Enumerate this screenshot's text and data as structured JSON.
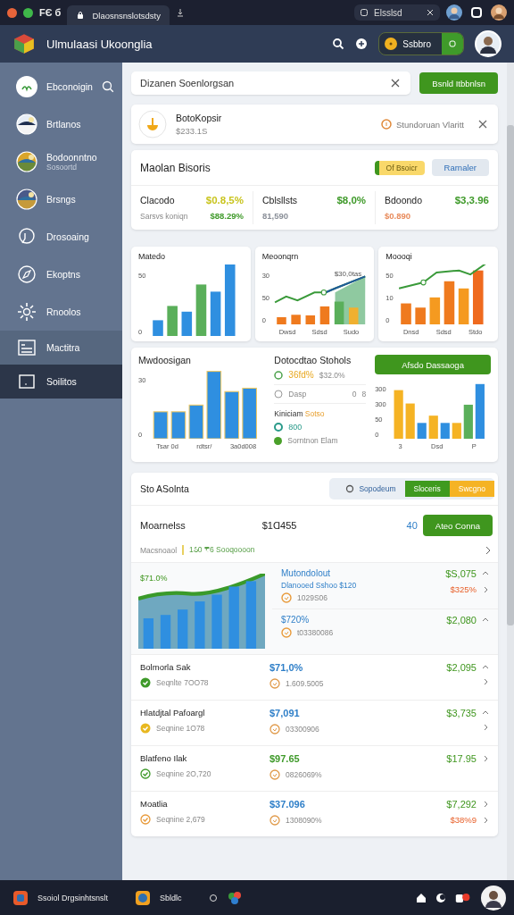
{
  "browser": {
    "app_label": "FЄ б",
    "tab_title": "Dlaosnsnslotsdsty",
    "address": "Elsslsd"
  },
  "header": {
    "title": "Ulmulaasi Ukoonglia",
    "pill_label": "Ssbbro"
  },
  "sidebar": {
    "items": [
      {
        "label": "Ebconoigin",
        "kind": "logo",
        "highlighted": false,
        "selected": false
      },
      {
        "label": "Brtlanos",
        "kind": "picture",
        "highlighted": false,
        "selected": false
      },
      {
        "label": "Bodoonntno",
        "subtitle": "Sosoortd",
        "kind": "picture",
        "highlighted": false,
        "selected": false
      },
      {
        "label": "Brsngs",
        "kind": "picture",
        "highlighted": false,
        "selected": false
      },
      {
        "label": "Drosoaing",
        "kind": "chat",
        "highlighted": false,
        "selected": false
      },
      {
        "label": "Ekoptns",
        "kind": "compass",
        "highlighted": false,
        "selected": false
      },
      {
        "label": "Rnoolos",
        "kind": "gear",
        "highlighted": false,
        "selected": false
      },
      {
        "label": "Mactitra",
        "kind": "list",
        "highlighted": true,
        "selected": false
      },
      {
        "label": "Soilitos",
        "kind": "square",
        "highlighted": false,
        "selected": true
      }
    ]
  },
  "search": {
    "value": "Dizanen Soenlorgsan",
    "button": "Bsnld Itbbnlsn"
  },
  "notice": {
    "title": "BotoKopsir",
    "amount": "$233.1Ѕ",
    "chip": "Stundoruan Vlaritt"
  },
  "summary": {
    "title": "Maolan Bisoris",
    "badge": "Of Bsoicr",
    "button": "Rarnaler",
    "metrics": [
      {
        "name": "Clacodo",
        "value": {
          "text": "$0.8,5%",
          "color": "#c9c41e"
        },
        "sub": "Sarsvs koniqn",
        "sub_value": {
          "text": "$88.29%",
          "color": "#3f9a2a"
        }
      },
      {
        "name": "Cblsllsts",
        "value": {
          "text": "$8,0%",
          "color": "#3f9a2a"
        },
        "sub_value": {
          "text": "81,590",
          "color": "#8a8f98"
        }
      },
      {
        "name": "Bdoondo",
        "value": {
          "text": "$3,3.96",
          "color": "#3f9a2a"
        },
        "sub_value": {
          "text": "$0.890",
          "color": "#e88a5a"
        }
      }
    ]
  },
  "charts": [
    {
      "title": "Matedo",
      "kind": "bars",
      "ticks": [
        "50",
        "0"
      ]
    },
    {
      "title": "Meoonqrn",
      "kind": "combo_area",
      "label": "$30,0tas",
      "ticks": [
        "30",
        "50",
        "0"
      ],
      "x_labels": [
        "Dwsd",
        "Sdsd",
        "Sudo"
      ]
    },
    {
      "title": "Moooqi",
      "kind": "combo",
      "ticks": [
        "50",
        "10",
        "0"
      ],
      "x_labels": [
        "Dnsd",
        "Sdsd",
        "Stdo"
      ]
    }
  ],
  "detail": {
    "title": "Mwdoosigan",
    "ticks": [
      "30",
      "0"
    ],
    "x_labels": [
      "Tsar 0d",
      "rdtsr/",
      "3a0d008"
    ],
    "stats_title": "Dotocdtao Stohols",
    "stat_primary": "36fd%",
    "stat_secondary": "$32.0%",
    "line_label": "Dasp",
    "line_values": [
      "0",
      "8"
    ],
    "sub_title": "Kiniciam",
    "sub_title_accent": "Sotso",
    "count": "800",
    "legend": "Sorntnon Elam",
    "button": "Afsdo Dassaoga",
    "right_ticks": [
      "300",
      "300",
      "50",
      "0"
    ],
    "right_x_labels": [
      "3",
      "Dsd",
      "P"
    ]
  },
  "accounts": {
    "title": "Sto ASolnta",
    "segments": [
      {
        "label": "Sopodeum",
        "kind": "plain"
      },
      {
        "label": "Sloceris",
        "kind": "filled",
        "color": "#3f9a1e"
      },
      {
        "label": "Swcgno",
        "kind": "filled",
        "color": "#f5b324"
      }
    ],
    "name": "Moarnelss",
    "total": "$1Ɑ455",
    "count": "40",
    "button": "Ateo Conna",
    "sub_name": "Macsnoaol",
    "sub_value": "1ઠ0 ₹6 Sooqoooon",
    "chart_label": "$71.0%",
    "featured": [
      {
        "title": "Mutondolout",
        "detail": "Dlanooed Sshoo $120",
        "code": "1029S06",
        "value": "$S,075",
        "value_sub": "$325%"
      },
      {
        "title": "$720%",
        "code": "t03380086",
        "value": "$2,080"
      }
    ],
    "rows": [
      {
        "name": "Bolmorla Sak",
        "status": {
          "text": "Seqnlte 7ОО78",
          "color": "#3f9a2a",
          "filled": true
        },
        "amount": {
          "text": "$71,0%",
          "color": "#2f7fc8"
        },
        "code": "1.609.5005",
        "value": "$2,095",
        "expanded": true
      },
      {
        "name": "Hlatdjtal Pafoargl",
        "status": {
          "text": "Seqnine 1О78",
          "color": "#e8b820",
          "filled": true
        },
        "amount": {
          "text": "$7,091",
          "color": "#2f7fc8"
        },
        "code": "03300906",
        "value": "$3,735",
        "expanded": true
      },
      {
        "name": "Blatfeno Ilak",
        "status": {
          "text": "Seqnine 2О,720",
          "color": "#3f9a2a",
          "filled": false
        },
        "amount": {
          "text": "$97.65",
          "color": "#3f9a2a"
        },
        "code": "0826069%",
        "value": "$17.95",
        "expanded": false
      },
      {
        "name": "Moatlia",
        "status": {
          "text": "Seqnine 2,679",
          "color": "#e89a3a",
          "filled": false
        },
        "amount": {
          "text": "$37.096",
          "color": "#2f7fc8"
        },
        "code": "1308090%",
        "value": "$7,292",
        "value_sub": "$38%9",
        "expanded": false
      }
    ]
  },
  "taskbar": {
    "app_label": "Ssoiol Drgsinhtsnslt",
    "running": "Sbldlc"
  }
}
